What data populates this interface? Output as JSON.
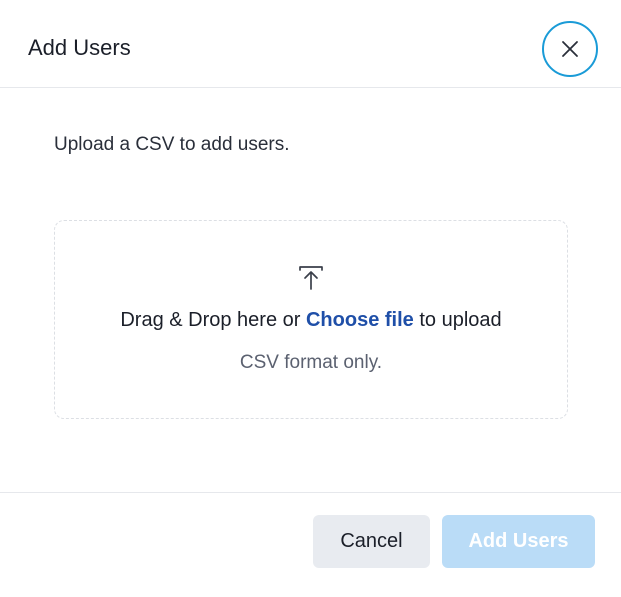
{
  "dialog": {
    "title": "Add Users",
    "close_icon": "close-icon"
  },
  "body": {
    "intro": "Upload a CSV to add users.",
    "dropzone": {
      "icon": "upload-icon",
      "prefix": "Drag & Drop here or ",
      "link_label": "Choose file",
      "suffix": " to upload",
      "format_note": "CSV format only."
    }
  },
  "footer": {
    "cancel_label": "Cancel",
    "submit_label": "Add Users",
    "submit_disabled": true
  },
  "colors": {
    "accent": "#1a9bd7",
    "link": "#1f4fa8",
    "submit_disabled_bg": "#badcf7",
    "cancel_bg": "#e8ebf0"
  }
}
